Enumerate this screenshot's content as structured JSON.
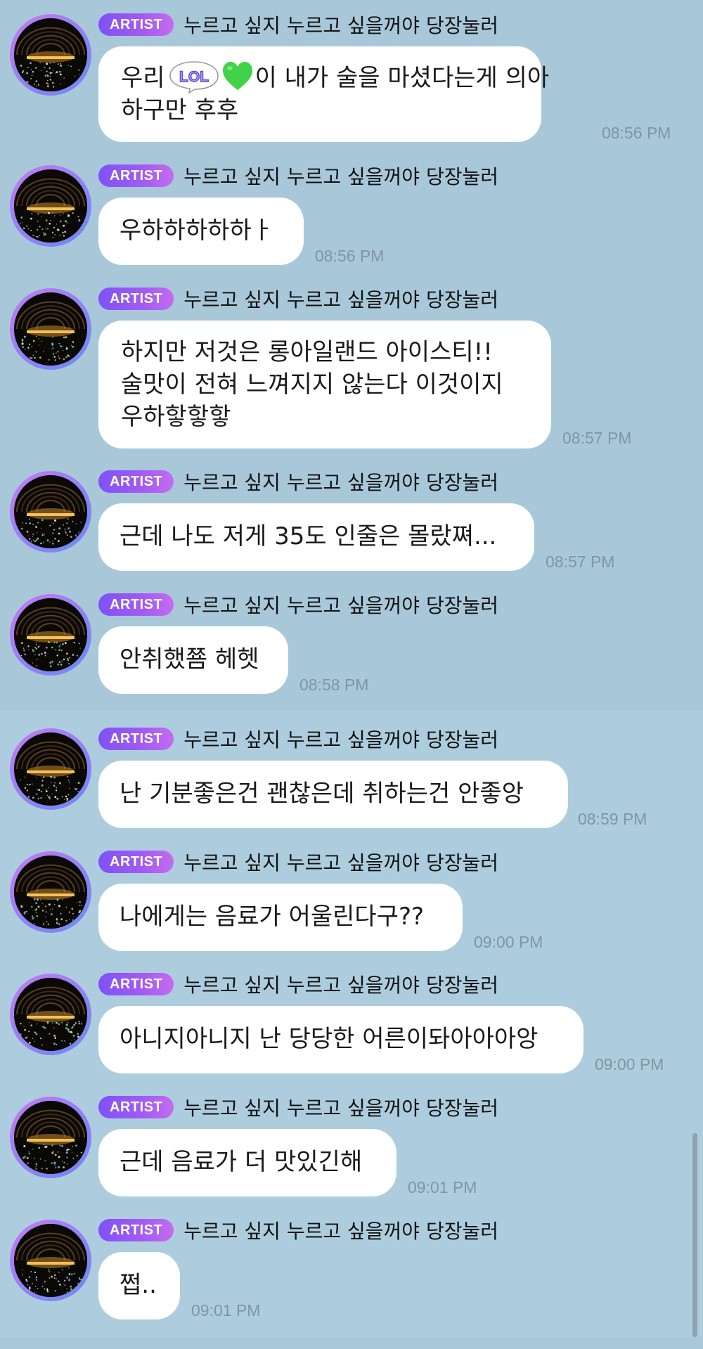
{
  "chat": {
    "badge_label": "ARTIST",
    "sender_name": "누르고 싶지 누르고 싶을꺼야 당장눌러",
    "messages": [
      {
        "lines": [
          "우리",
          "이 내가 술을 마셨다는게 의아",
          "하구만 후후"
        ],
        "stickers": [
          "lol-sticker",
          "green-heart-emoji"
        ],
        "time": "08:56 PM"
      },
      {
        "lines": [
          "우하하하하하ㅏ"
        ],
        "time": "08:56 PM"
      },
      {
        "lines": [
          "하지만 저것은 롱아일랜드 아이스티!!",
          "술맛이 전혀 느껴지지 않는다 이것이지",
          "우하핳핳핳"
        ],
        "time": "08:57 PM"
      },
      {
        "lines": [
          "근데 나도 저게 35도 인줄은 몰랐쪄..."
        ],
        "time": "08:57 PM"
      },
      {
        "lines": [
          "안취했쬼 헤헷"
        ],
        "time": "08:58 PM"
      },
      {
        "lines": [
          "난 기분좋은건 괜찮은데 취하는건 안좋앙"
        ],
        "time": "08:59 PM"
      },
      {
        "lines": [
          "나에게는 음료가 어울린다구??"
        ],
        "time": "09:00 PM"
      },
      {
        "lines": [
          "아니지아니지 난 당당한 어른이돠아아아앙"
        ],
        "time": "09:00 PM"
      },
      {
        "lines": [
          "근데 음료가 더 맛있긴해"
        ],
        "time": "09:01 PM"
      },
      {
        "lines": [
          "쩝.."
        ],
        "time": "09:01 PM"
      }
    ]
  },
  "colors": {
    "background": "#A9C9DA",
    "bubble": "#FFFFFF",
    "badge_start": "#7E52F5",
    "badge_end": "#C46CF0",
    "timestamp": "#7F95A2",
    "heart": "#3FD24A"
  }
}
